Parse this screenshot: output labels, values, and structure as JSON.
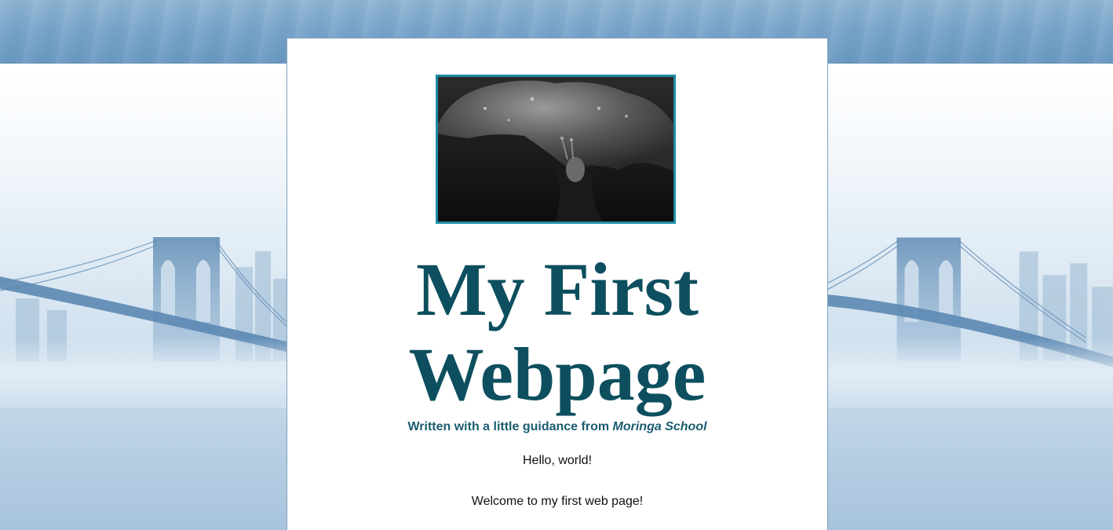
{
  "page": {
    "title_line1": "My First",
    "title_line2": "Webpage",
    "byline_prefix": "Written with a little guidance from",
    "byline_school": "Moringa School",
    "paragraphs": [
      "Hello, world!",
      "Welcome to my first web page!"
    ]
  },
  "hero_image": {
    "subject": "black-and-white photo of a snail on a leaf"
  },
  "background": {
    "subject": "foggy bridge over water, repeated tile"
  },
  "colors": {
    "title": "#0d4f5e",
    "byline": "#1b5c70",
    "image_border": "#1c8da6",
    "sky_band": "#7ba6cb"
  }
}
